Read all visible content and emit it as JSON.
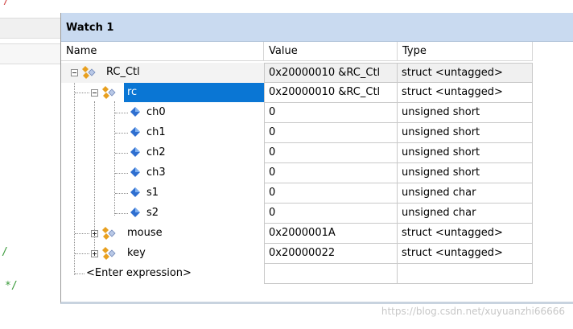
{
  "window": {
    "title": "Watch 1"
  },
  "columns": {
    "name": "Name",
    "value": "Value",
    "type": "Type"
  },
  "rows": [
    {
      "name": "RC_Ctl",
      "value": "0x20000010 &RC_Ctl",
      "type": "struct <untagged>",
      "kind": "struct",
      "expanded": true
    },
    {
      "name": "rc",
      "value": "0x20000010 &RC_Ctl",
      "type": "struct <untagged>",
      "kind": "struct",
      "expanded": true,
      "selected": true
    },
    {
      "name": "ch0",
      "value": "0",
      "type": "unsigned short",
      "kind": "variable"
    },
    {
      "name": "ch1",
      "value": "0",
      "type": "unsigned short",
      "kind": "variable"
    },
    {
      "name": "ch2",
      "value": "0",
      "type": "unsigned short",
      "kind": "variable"
    },
    {
      "name": "ch3",
      "value": "0",
      "type": "unsigned short",
      "kind": "variable"
    },
    {
      "name": "s1",
      "value": "0",
      "type": "unsigned char",
      "kind": "variable"
    },
    {
      "name": "s2",
      "value": "0",
      "type": "unsigned char",
      "kind": "variable"
    },
    {
      "name": "mouse",
      "value": "0x2000001A",
      "type": "struct <untagged>",
      "kind": "struct",
      "expanded": false
    },
    {
      "name": "key",
      "value": "0x20000022",
      "type": "struct <untagged>",
      "kind": "struct",
      "expanded": false
    },
    {
      "name": "<Enter expression>",
      "value": "",
      "type": "",
      "kind": "placeholder"
    }
  ],
  "editor": {
    "marks": [
      "/",
      "/",
      "*/"
    ]
  },
  "watermark": "https://blog.csdn.net/xuyuanzhi66666",
  "colors": {
    "titlebar": "#c9daf0",
    "selection": "#0a76d4",
    "struct_icon": "#e8a020",
    "var_icon": "#2f6fd0"
  }
}
